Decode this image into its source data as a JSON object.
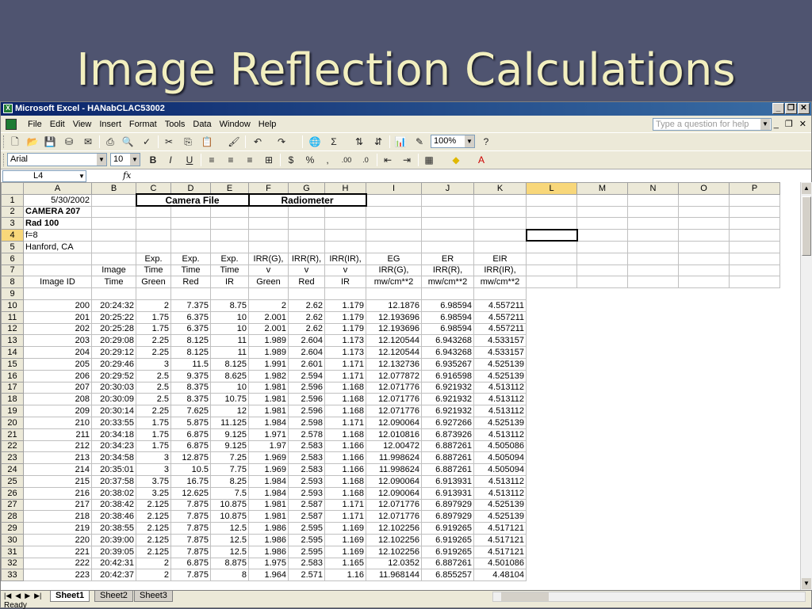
{
  "slide": {
    "title": "Image Reflection Calculations"
  },
  "window": {
    "title": "Microsoft Excel - HANabCLAC53002"
  },
  "menu": [
    "File",
    "Edit",
    "View",
    "Insert",
    "Format",
    "Tools",
    "Data",
    "Window",
    "Help"
  ],
  "help_placeholder": "Type a question for help",
  "toolbar": {
    "zoom": "100%",
    "font_name": "Arial",
    "font_size": "10"
  },
  "name_box": "L4",
  "fx_label": "fx",
  "columns": [
    "A",
    "B",
    "C",
    "D",
    "E",
    "F",
    "G",
    "H",
    "I",
    "J",
    "K",
    "L",
    "M",
    "N",
    "O",
    "P"
  ],
  "header": {
    "r1_date": "5/30/2002",
    "camera_file": "Camera File",
    "radiometer": "Radiometer",
    "r2": "CAMERA 207",
    "r3": "Rad 100",
    "r4": "f=8",
    "r5": "Hanford, CA",
    "r6": [
      "",
      "",
      "Exp.",
      "Exp.",
      "Exp.",
      "IRR(G),",
      "IRR(R),",
      "IRR(IR),",
      "EG",
      "ER",
      "EIR"
    ],
    "r7": [
      "",
      "Image",
      "Time",
      "Time",
      "Time",
      "v",
      "v",
      "v",
      "IRR(G),",
      "IRR(R),",
      "IRR(IR),"
    ],
    "r8": [
      "Image ID",
      "Time",
      "Green",
      "Red",
      "IR",
      "Green",
      "Red",
      "IR",
      "mw/cm**2",
      "mw/cm**2",
      "mw/cm**2"
    ]
  },
  "rows": [
    {
      "n": "10",
      "c": [
        "200",
        "20:24:32",
        "2",
        "7.375",
        "8.75",
        "2",
        "2.62",
        "1.179",
        "12.1876",
        "6.98594",
        "4.557211"
      ]
    },
    {
      "n": "11",
      "c": [
        "201",
        "20:25:22",
        "1.75",
        "6.375",
        "10",
        "2.001",
        "2.62",
        "1.179",
        "12.193696",
        "6.98594",
        "4.557211"
      ]
    },
    {
      "n": "12",
      "c": [
        "202",
        "20:25:28",
        "1.75",
        "6.375",
        "10",
        "2.001",
        "2.62",
        "1.179",
        "12.193696",
        "6.98594",
        "4.557211"
      ]
    },
    {
      "n": "13",
      "c": [
        "203",
        "20:29:08",
        "2.25",
        "8.125",
        "11",
        "1.989",
        "2.604",
        "1.173",
        "12.120544",
        "6.943268",
        "4.533157"
      ]
    },
    {
      "n": "14",
      "c": [
        "204",
        "20:29:12",
        "2.25",
        "8.125",
        "11",
        "1.989",
        "2.604",
        "1.173",
        "12.120544",
        "6.943268",
        "4.533157"
      ]
    },
    {
      "n": "15",
      "c": [
        "205",
        "20:29:46",
        "3",
        "11.5",
        "8.125",
        "1.991",
        "2.601",
        "1.171",
        "12.132736",
        "6.935267",
        "4.525139"
      ]
    },
    {
      "n": "16",
      "c": [
        "206",
        "20:29:52",
        "2.5",
        "9.375",
        "8.625",
        "1.982",
        "2.594",
        "1.171",
        "12.077872",
        "6.916598",
        "4.525139"
      ]
    },
    {
      "n": "17",
      "c": [
        "207",
        "20:30:03",
        "2.5",
        "8.375",
        "10",
        "1.981",
        "2.596",
        "1.168",
        "12.071776",
        "6.921932",
        "4.513112"
      ]
    },
    {
      "n": "18",
      "c": [
        "208",
        "20:30:09",
        "2.5",
        "8.375",
        "10.75",
        "1.981",
        "2.596",
        "1.168",
        "12.071776",
        "6.921932",
        "4.513112"
      ]
    },
    {
      "n": "19",
      "c": [
        "209",
        "20:30:14",
        "2.25",
        "7.625",
        "12",
        "1.981",
        "2.596",
        "1.168",
        "12.071776",
        "6.921932",
        "4.513112"
      ]
    },
    {
      "n": "20",
      "c": [
        "210",
        "20:33:55",
        "1.75",
        "5.875",
        "11.125",
        "1.984",
        "2.598",
        "1.171",
        "12.090064",
        "6.927266",
        "4.525139"
      ]
    },
    {
      "n": "21",
      "c": [
        "211",
        "20:34:18",
        "1.75",
        "6.875",
        "9.125",
        "1.971",
        "2.578",
        "1.168",
        "12.010816",
        "6.873926",
        "4.513112"
      ]
    },
    {
      "n": "22",
      "c": [
        "212",
        "20:34:23",
        "1.75",
        "6.875",
        "9.125",
        "1.97",
        "2.583",
        "1.166",
        "12.00472",
        "6.887261",
        "4.505086"
      ]
    },
    {
      "n": "23",
      "c": [
        "213",
        "20:34:58",
        "3",
        "12.875",
        "7.25",
        "1.969",
        "2.583",
        "1.166",
        "11.998624",
        "6.887261",
        "4.505094"
      ]
    },
    {
      "n": "24",
      "c": [
        "214",
        "20:35:01",
        "3",
        "10.5",
        "7.75",
        "1.969",
        "2.583",
        "1.166",
        "11.998624",
        "6.887261",
        "4.505094"
      ]
    },
    {
      "n": "25",
      "c": [
        "215",
        "20:37:58",
        "3.75",
        "16.75",
        "8.25",
        "1.984",
        "2.593",
        "1.168",
        "12.090064",
        "6.913931",
        "4.513112"
      ]
    },
    {
      "n": "26",
      "c": [
        "216",
        "20:38:02",
        "3.25",
        "12.625",
        "7.5",
        "1.984",
        "2.593",
        "1.168",
        "12.090064",
        "6.913931",
        "4.513112"
      ]
    },
    {
      "n": "27",
      "c": [
        "217",
        "20:38:42",
        "2.125",
        "7.875",
        "10.875",
        "1.981",
        "2.587",
        "1.171",
        "12.071776",
        "6.897929",
        "4.525139"
      ]
    },
    {
      "n": "28",
      "c": [
        "218",
        "20:38:46",
        "2.125",
        "7.875",
        "10.875",
        "1.981",
        "2.587",
        "1.171",
        "12.071776",
        "6.897929",
        "4.525139"
      ]
    },
    {
      "n": "29",
      "c": [
        "219",
        "20:38:55",
        "2.125",
        "7.875",
        "12.5",
        "1.986",
        "2.595",
        "1.169",
        "12.102256",
        "6.919265",
        "4.517121"
      ]
    },
    {
      "n": "30",
      "c": [
        "220",
        "20:39:00",
        "2.125",
        "7.875",
        "12.5",
        "1.986",
        "2.595",
        "1.169",
        "12.102256",
        "6.919265",
        "4.517121"
      ]
    },
    {
      "n": "31",
      "c": [
        "221",
        "20:39:05",
        "2.125",
        "7.875",
        "12.5",
        "1.986",
        "2.595",
        "1.169",
        "12.102256",
        "6.919265",
        "4.517121"
      ]
    },
    {
      "n": "32",
      "c": [
        "222",
        "20:42:31",
        "2",
        "6.875",
        "8.875",
        "1.975",
        "2.583",
        "1.165",
        "12.0352",
        "6.887261",
        "4.501086"
      ]
    },
    {
      "n": "33",
      "c": [
        "223",
        "20:42:37",
        "2",
        "7.875",
        "8",
        "1.964",
        "2.571",
        "1.16",
        "11.968144",
        "6.855257",
        "4.48104"
      ]
    }
  ],
  "sheets": [
    "Sheet1",
    "Sheet2",
    "Sheet3"
  ],
  "status": "Ready"
}
